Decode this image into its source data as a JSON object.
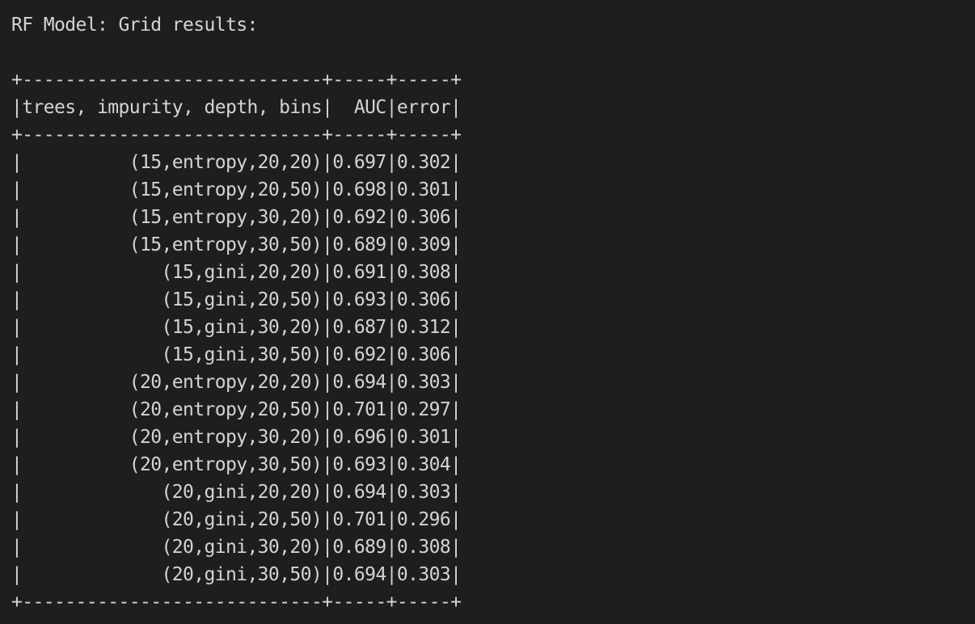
{
  "output": {
    "heading": "RF Model: Grid results:",
    "table": {
      "separator": "+----------------------------+-----+-----+",
      "header": "|trees, impurity, depth, bins|  AUC|error|",
      "rows": [
        "|          (15,entropy,20,20)|0.697|0.302|",
        "|          (15,entropy,20,50)|0.698|0.301|",
        "|          (15,entropy,30,20)|0.692|0.306|",
        "|          (15,entropy,30,50)|0.689|0.309|",
        "|             (15,gini,20,20)|0.691|0.308|",
        "|             (15,gini,20,50)|0.693|0.306|",
        "|             (15,gini,30,20)|0.687|0.312|",
        "|             (15,gini,30,50)|0.692|0.306|",
        "|          (20,entropy,20,20)|0.694|0.303|",
        "|          (20,entropy,20,50)|0.701|0.297|",
        "|          (20,entropy,30,20)|0.696|0.301|",
        "|          (20,entropy,30,50)|0.693|0.304|",
        "|             (20,gini,20,20)|0.694|0.303|",
        "|             (20,gini,20,50)|0.701|0.296|",
        "|             (20,gini,30,20)|0.689|0.308|",
        "|             (20,gini,30,50)|0.694|0.303|"
      ]
    }
  }
}
